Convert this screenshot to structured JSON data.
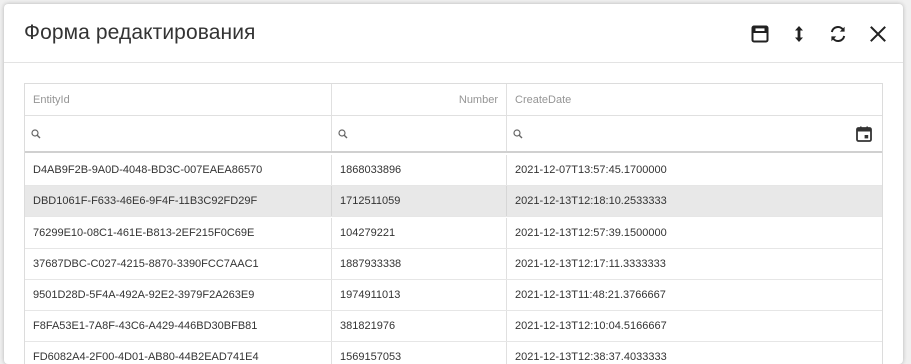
{
  "dialog": {
    "title": "Форма редактирования",
    "tools": [
      "save-icon",
      "expand-vertical-icon",
      "refresh-icon",
      "close-icon"
    ]
  },
  "grid": {
    "columns": [
      "EntityId",
      "Number",
      "CreateDate"
    ],
    "filters": {
      "entity_id": "",
      "number": "",
      "create_date": ""
    },
    "rows": [
      [
        "D4AB9F2B-9A0D-4048-BD3C-007EAEA86570",
        "1868033896",
        "2021-12-07T13:57:45.1700000"
      ],
      [
        "DBD1061F-F633-46E6-9F4F-11B3C92FD29F",
        "1712511059",
        "2021-12-13T12:18:10.2533333"
      ],
      [
        "76299E10-08C1-461E-B813-2EF215F0C69E",
        "104279221",
        "2021-12-13T12:57:39.1500000"
      ],
      [
        "37687DBC-C027-4215-8870-3390FCC7AAC1",
        "1887933338",
        "2021-12-13T12:17:11.3333333"
      ],
      [
        "9501D28D-5F4A-492A-92E2-3979F2A263E9",
        "1974911013",
        "2021-12-13T11:48:21.3766667"
      ],
      [
        "F8FA53E1-7A8F-43C6-A429-446BD30BFB81",
        "381821976",
        "2021-12-13T12:10:04.5166667"
      ],
      [
        "FD6082A4-2F00-4D01-AB80-44B2EAD741E4",
        "1569157053",
        "2021-12-13T12:38:37.4033333"
      ]
    ],
    "selected_row": 1,
    "colors": {
      "selected": "#e8e8e8",
      "border": "#e0e0e0",
      "header_text": "#959595"
    }
  }
}
